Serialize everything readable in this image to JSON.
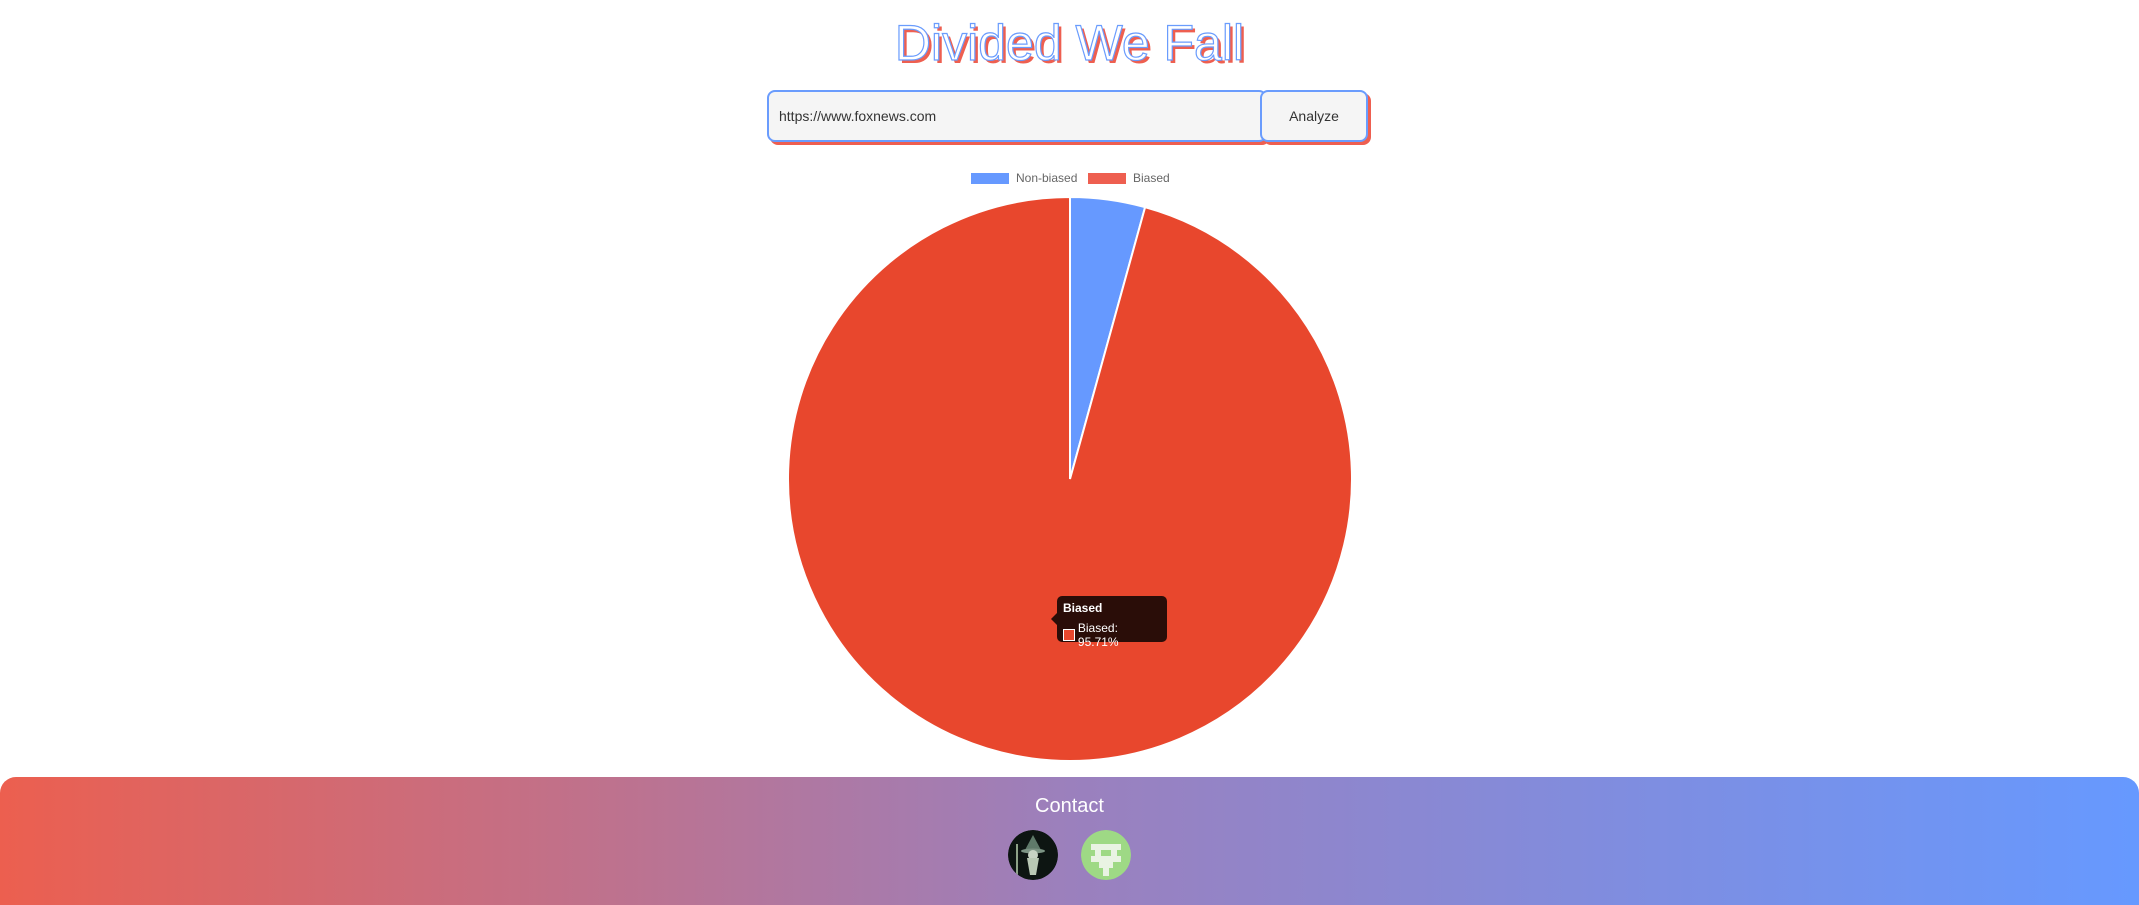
{
  "header": {
    "title": "Divided We Fall"
  },
  "search": {
    "url_value": "https://www.foxnews.com",
    "analyze_label": "Analyze"
  },
  "colors": {
    "blue": "#6699ff",
    "red": "#e8472d",
    "red_legend": "#ee5f50"
  },
  "chart_data": {
    "type": "pie",
    "categories": [
      "Non-biased",
      "Biased"
    ],
    "values": [
      4.29,
      95.71
    ],
    "colors": [
      "#6699ff",
      "#e8472d"
    ],
    "legend_position": "top",
    "tooltip": {
      "title": "Biased",
      "label": "Biased: 95.71%"
    }
  },
  "footer": {
    "title": "Contact",
    "links": [
      {
        "icon": "wizard-avatar-icon"
      },
      {
        "icon": "pixel-face-avatar-icon"
      }
    ]
  }
}
